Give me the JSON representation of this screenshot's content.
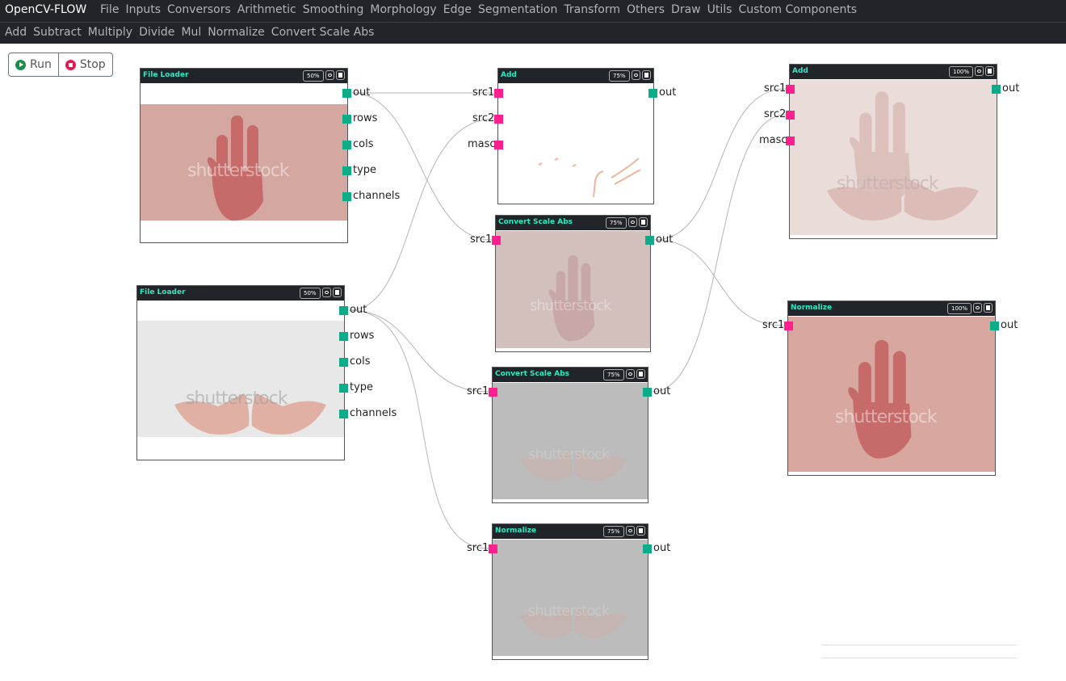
{
  "app": {
    "brand": "OpenCV-FLOW"
  },
  "menu": [
    "File",
    "Inputs",
    "Conversors",
    "Arithmetic",
    "Smoothing",
    "Morphology",
    "Edge",
    "Segmentation",
    "Transform",
    "Others",
    "Draw",
    "Utils",
    "Custom Components"
  ],
  "submenu": [
    "Add",
    "Subtract",
    "Multiply",
    "Divide",
    "Mul",
    "Normalize",
    "Convert Scale Abs"
  ],
  "toolbar": {
    "run_label": "Run",
    "stop_label": "Stop"
  },
  "watermark": "shutterstock",
  "colors": {
    "header": "#212529",
    "title": "#2ee8c2",
    "port_in": "#ff1f8f",
    "port_out": "#0dab87"
  },
  "nodes": {
    "fl1": {
      "title": "File Loader",
      "zoom": "50%",
      "outputs": [
        "out",
        "rows",
        "cols",
        "type",
        "channels"
      ]
    },
    "fl2": {
      "title": "File Loader",
      "zoom": "50%",
      "outputs": [
        "out",
        "rows",
        "cols",
        "type",
        "channels"
      ]
    },
    "add1": {
      "title": "Add",
      "zoom": "75%",
      "inputs": [
        "src1",
        "src2",
        "masc"
      ],
      "outputs": [
        "out"
      ]
    },
    "csa1": {
      "title": "Convert Scale Abs",
      "zoom": "75%",
      "inputs": [
        "src1"
      ],
      "outputs": [
        "out"
      ]
    },
    "csa2": {
      "title": "Convert Scale Abs",
      "zoom": "75%",
      "inputs": [
        "src1"
      ],
      "outputs": [
        "out"
      ]
    },
    "norm1": {
      "title": "Normalize",
      "zoom": "75%",
      "inputs": [
        "src1"
      ],
      "outputs": [
        "out"
      ]
    },
    "add2": {
      "title": "Add",
      "zoom": "100%",
      "inputs": [
        "src1",
        "src2",
        "masc"
      ],
      "outputs": [
        "out"
      ]
    },
    "norm2": {
      "title": "Normalize",
      "zoom": "100%",
      "inputs": [
        "src1"
      ],
      "outputs": [
        "out"
      ]
    }
  }
}
